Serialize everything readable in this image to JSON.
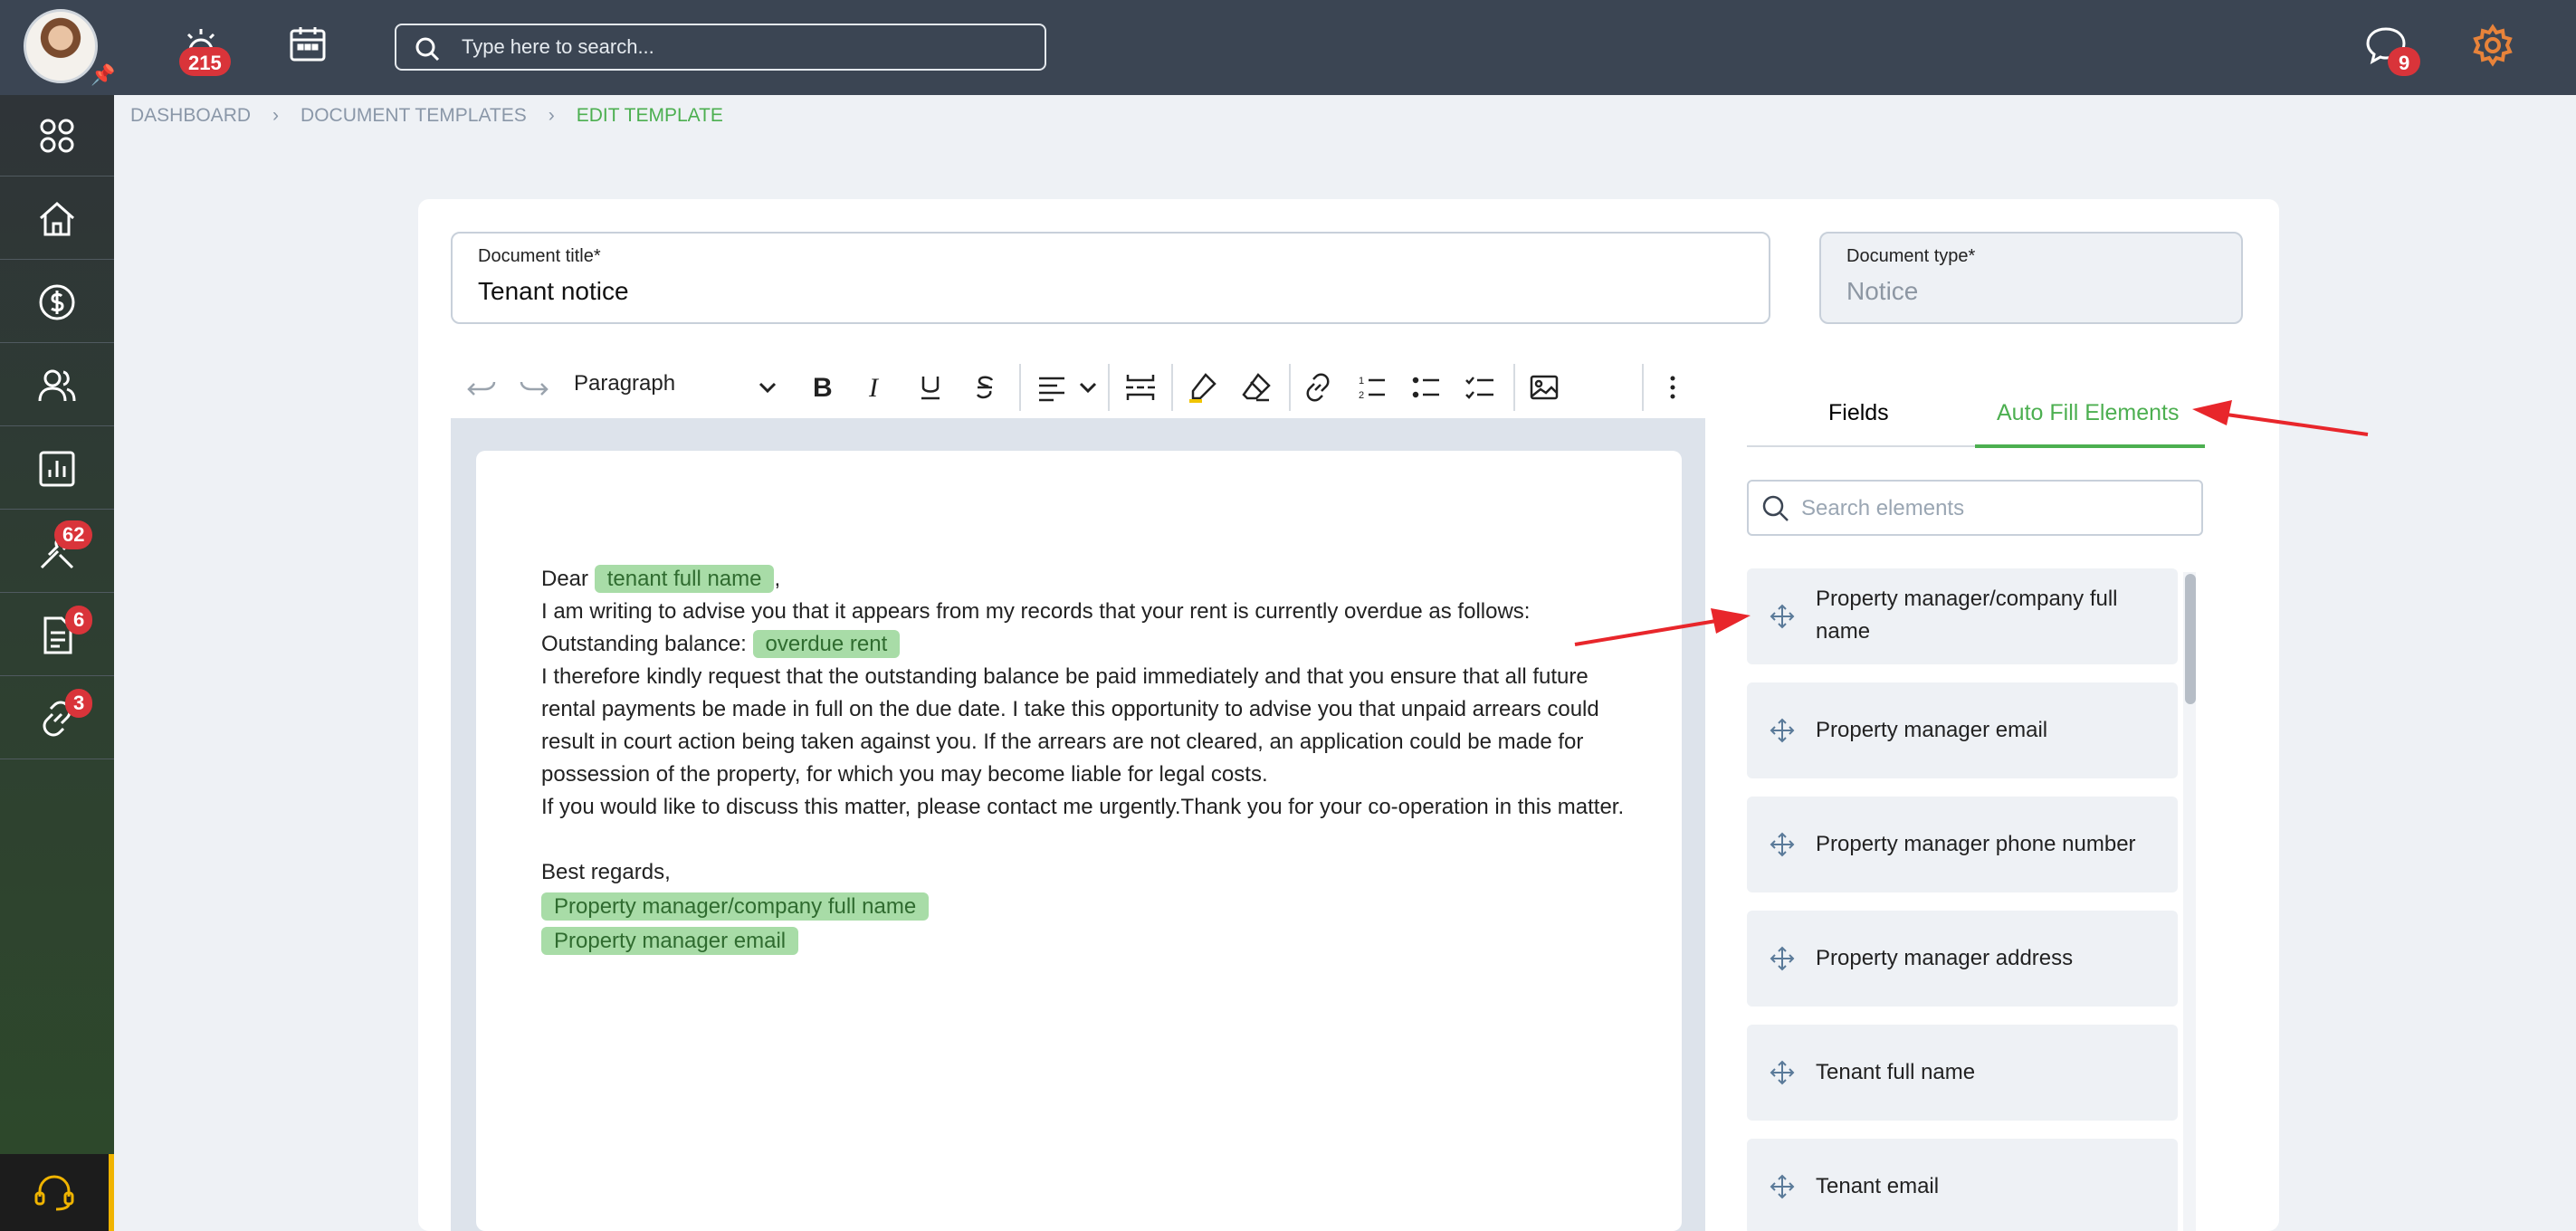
{
  "topbar": {
    "alarm_count": "215",
    "search_placeholder": "Type here to search...",
    "messages_count": "9"
  },
  "sidebar": {
    "tools_badge": "62",
    "documents_badge": "6",
    "links_badge": "3"
  },
  "breadcrumb": [
    "DASHBOARD",
    "DOCUMENT TEMPLATES",
    "EDIT TEMPLATE"
  ],
  "form": {
    "title_label": "Document title*",
    "title_value": "Tenant notice",
    "type_label": "Document type*",
    "type_value": "Notice"
  },
  "toolbar": {
    "paragraph_label": "Paragraph"
  },
  "document": {
    "greeting": "Dear",
    "tenant_chip": "tenant full name",
    "comma": ",",
    "line1": "I am writing to advise you that it appears from my records that your rent is currently overdue as follows:",
    "balance_label": "Outstanding balance:",
    "overdue_chip": "overdue rent",
    "paragraph": "I therefore kindly request that the outstanding balance be paid immediately and that you ensure that all future rental payments be made in full on the due date. I take this opportunity to advise you that unpaid arrears could result in court action being taken against you. If the arrears are not cleared, an application could be made for possession of the property, for which you may become liable for legal costs.",
    "closing_para": "If you would like to discuss this matter, please contact me urgently.Thank you for your co-operation in this matter.",
    "regards": "Best regards,",
    "signature_chip1": "Property manager/company full name",
    "signature_chip2": "Property manager email"
  },
  "panel": {
    "tabs": [
      "Fields",
      "Auto Fill Elements"
    ],
    "active_tab": "Auto Fill Elements",
    "search_placeholder": "Search elements",
    "elements": [
      "Property manager/company full name",
      "Property manager email",
      "Property manager phone number",
      "Property manager address",
      "Tenant full name",
      "Tenant email"
    ]
  },
  "colors": {
    "accent_green": "#4caf50",
    "topbar": "#3b4553",
    "badge_red": "#d9343a",
    "settings_orange": "#e8833a",
    "annotation_arrow": "#e8262b"
  }
}
